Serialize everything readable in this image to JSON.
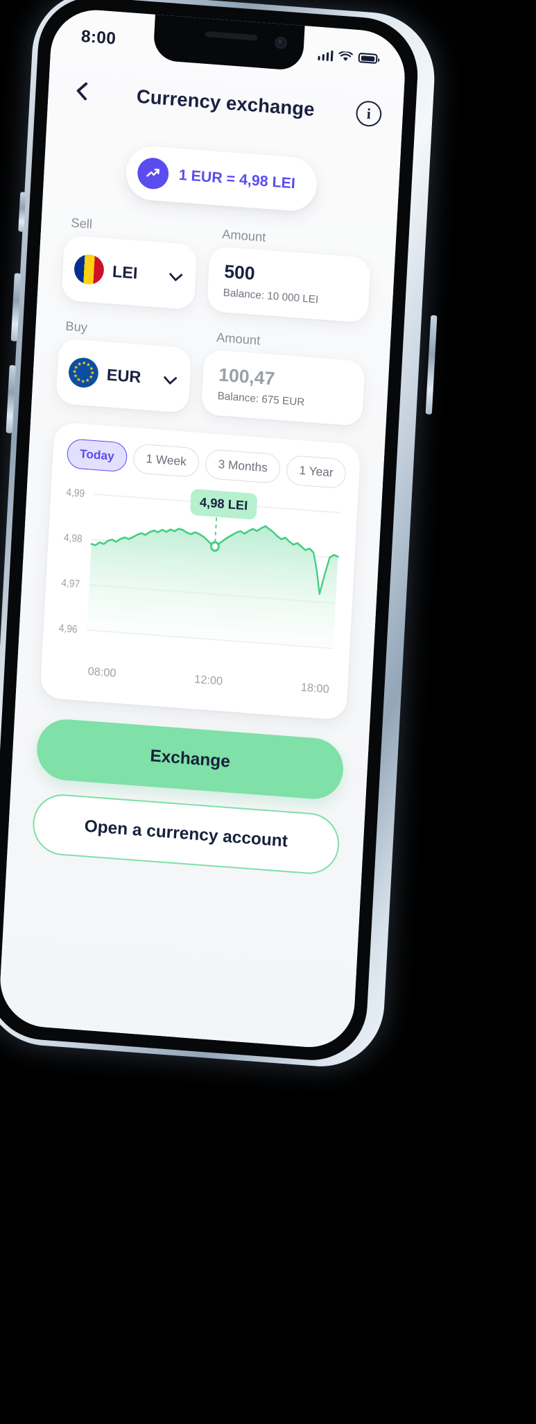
{
  "status_bar": {
    "time": "8:00",
    "signal_icon": "cellular-bars-icon",
    "wifi_icon": "wifi-icon",
    "battery_icon": "battery-full-icon"
  },
  "app_bar": {
    "back_icon": "chevron-left-icon",
    "title": "Currency exchange",
    "info_label": "i",
    "info_icon": "info-circle-icon"
  },
  "rate_badge": {
    "icon": "trending-up-icon",
    "text": "1 EUR = 4,98 LEI",
    "accent_color": "#5b4cf0"
  },
  "sell": {
    "label": "Sell",
    "amount_label": "Amount",
    "currency": "LEI",
    "flag_icon": "flag-romania-icon",
    "chevron_icon": "chevron-down-icon",
    "amount_value": "500",
    "balance": "Balance: 10 000 LEI"
  },
  "buy": {
    "label": "Buy",
    "amount_label": "Amount",
    "currency": "EUR",
    "flag_icon": "flag-eu-icon",
    "chevron_icon": "chevron-down-icon",
    "amount_value": "100,47",
    "balance": "Balance: 675 EUR"
  },
  "chart_card": {
    "ranges": [
      {
        "label": "Today",
        "active": true
      },
      {
        "label": "1 Week",
        "active": false
      },
      {
        "label": "3 Months",
        "active": false
      },
      {
        "label": "1 Year",
        "active": false
      }
    ],
    "tooltip": "4,98 LEI"
  },
  "chart_data": {
    "type": "line",
    "title": "",
    "xlabel": "",
    "ylabel": "",
    "ylim": [
      4.96,
      4.99
    ],
    "y_ticks": [
      "4,99",
      "4,98",
      "4,97",
      "4,96"
    ],
    "x_ticks": [
      "08:00",
      "12:00",
      "18:00"
    ],
    "grid": true,
    "legend": "none",
    "line_color": "#41cf81",
    "fill_color": "#d9f6e6",
    "marker": {
      "label": "4,98 LEI",
      "x": "12:00",
      "y": 4.9805
    },
    "x": [
      0,
      1,
      2,
      3,
      4,
      5,
      6,
      7,
      8,
      9,
      10,
      11,
      12,
      13,
      14,
      15,
      16,
      17,
      18,
      19,
      20,
      21,
      22,
      23,
      24,
      25,
      26,
      27,
      28,
      29,
      30,
      31,
      32,
      33,
      34,
      35,
      36,
      37,
      38,
      39,
      40,
      41,
      42,
      43,
      44,
      45,
      46,
      47,
      48,
      49,
      50,
      51,
      52,
      53,
      54,
      55,
      56,
      57,
      58,
      59,
      60
    ],
    "y": [
      4.979,
      4.9788,
      4.9795,
      4.9792,
      4.98,
      4.9803,
      4.9799,
      4.9806,
      4.981,
      4.9807,
      4.9812,
      4.9818,
      4.9822,
      4.9819,
      4.9826,
      4.983,
      4.9827,
      4.9833,
      4.9829,
      4.9835,
      4.9832,
      4.9838,
      4.9836,
      4.9831,
      4.9828,
      4.9833,
      4.983,
      4.9825,
      4.9818,
      4.981,
      4.9805,
      4.9812,
      4.982,
      4.9827,
      4.9833,
      4.9839,
      4.9843,
      4.9838,
      4.9845,
      4.985,
      4.9846,
      4.9853,
      4.9858,
      4.9852,
      4.9846,
      4.9838,
      4.9832,
      4.9836,
      4.9828,
      4.9822,
      4.9826,
      4.9819,
      4.9812,
      4.9816,
      4.9808,
      4.977,
      4.9718,
      4.9762,
      4.98,
      4.9806,
      4.9803
    ]
  },
  "actions": {
    "primary": "Exchange",
    "secondary": "Open a currency account"
  }
}
